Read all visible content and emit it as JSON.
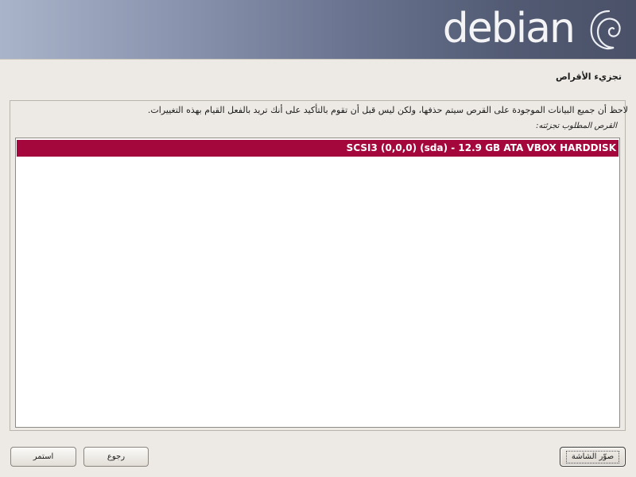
{
  "header": {
    "logo_text": "debian",
    "logo_icon": "debian-swirl-icon"
  },
  "page": {
    "title": "تجزيء الأقراص",
    "instruction": "لاحظ أن جميع البيانات الموجودة على القرص سيتم حذفها، ولكن ليس قبل أن تقوم بالتأكيد على أنك تريد بالفعل القيام بهذه التغييرات.",
    "list_label": "القرص المطلوب تجزئته:"
  },
  "disks": [
    {
      "label": "SCSI3 (0,0,0) (sda) - 12.9 GB ATA VBOX HARDDISK",
      "selected": true
    }
  ],
  "buttons": {
    "continue": "استمر",
    "back": "رجوع",
    "screenshot": "صوّر الشاشة"
  },
  "colors": {
    "selection": "#a3073b",
    "background": "#edeae5"
  }
}
